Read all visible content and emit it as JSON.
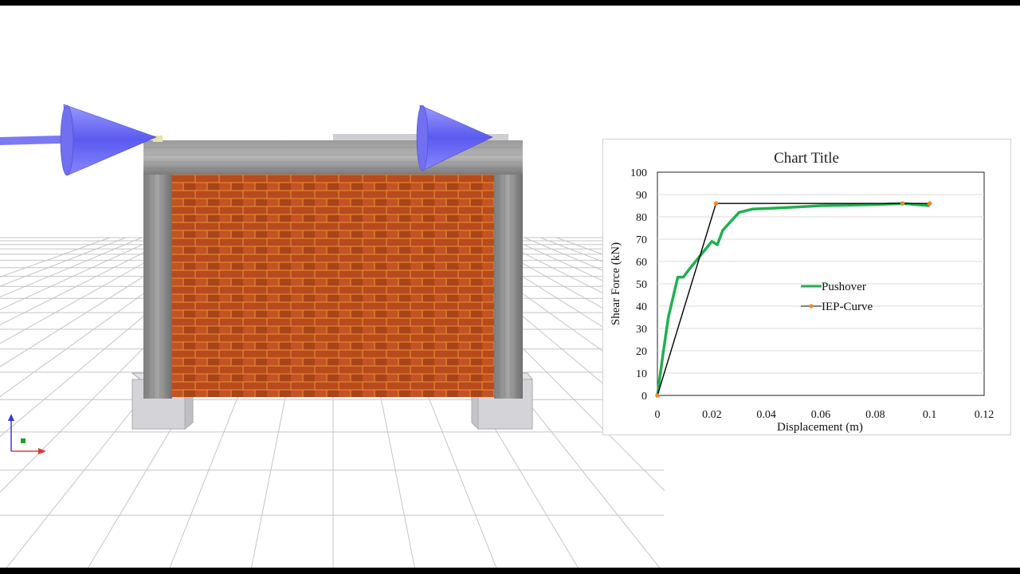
{
  "viewport": {
    "scene_objects": [
      "ground-grid",
      "rc-frame",
      "masonry-infill-wall",
      "footing-left",
      "footing-right",
      "load-arrow-left",
      "load-arrow-right",
      "axis-triad"
    ],
    "colors": {
      "brick": "#b84a1d",
      "mortar": "#e08a2a",
      "concrete": "#8f8f8f",
      "footing": "#d4d4d8",
      "arrow": "#6b6bf2",
      "grid": "#bdbdbd"
    }
  },
  "chart_data": {
    "type": "line",
    "title": "Chart Title",
    "xlabel": "Displacement  (m)",
    "ylabel": "Shear  Force (kN)",
    "xlim": [
      0,
      0.12
    ],
    "ylim": [
      0,
      100
    ],
    "xticks": [
      "0",
      "0.02",
      "0.04",
      "0.06",
      "0.08",
      "0.1",
      "0.12"
    ],
    "yticks": [
      "0",
      "10",
      "20",
      "30",
      "40",
      "50",
      "60",
      "70",
      "80",
      "90",
      "100"
    ],
    "grid": true,
    "legend_position": "center-right",
    "series": [
      {
        "name": "Pushover",
        "color": "#1fb050",
        "x": [
          0,
          0.002,
          0.004,
          0.0075,
          0.0095,
          0.012,
          0.016,
          0.02,
          0.022,
          0.024,
          0.027,
          0.03,
          0.035,
          0.045,
          0.06,
          0.08,
          0.09,
          0.1
        ],
        "y": [
          0,
          18,
          35,
          53,
          53,
          57,
          63,
          69,
          67.5,
          74,
          78,
          82,
          83.5,
          84,
          85,
          85.5,
          86,
          85
        ]
      },
      {
        "name": "IEP-Curve",
        "color": "#000000",
        "marker_color": "#e58a3a",
        "x": [
          0,
          0.0215,
          0.09,
          0.1
        ],
        "y": [
          0,
          86,
          86,
          86
        ]
      }
    ]
  }
}
